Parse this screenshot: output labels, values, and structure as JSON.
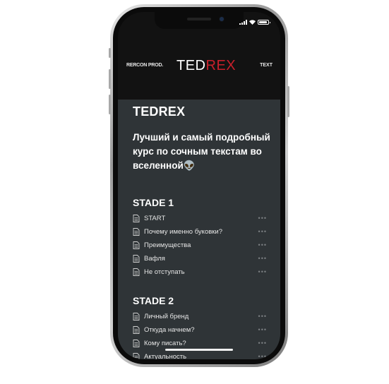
{
  "header": {
    "left_text": "RERCON PROD.",
    "logo_part1": "TED",
    "logo_part2": "REX",
    "right_text": "TEXT"
  },
  "page": {
    "title": "TEDREX",
    "subtitle": "Лучший и самый подробный курс по сочным текстам во вселенной👽"
  },
  "sections": [
    {
      "title": "STADE 1",
      "items": [
        "START",
        "Почему именно буковки?",
        "Преимущества",
        "Вафля",
        "Не отступать"
      ]
    },
    {
      "title": "STADE 2",
      "items": [
        "Личный бренд",
        "Откуда начнем?",
        "Кому писать?",
        "Актуальность"
      ]
    }
  ],
  "icons": {
    "page": "document-icon",
    "more": "more-dots-icon"
  },
  "colors": {
    "accent": "#c8202b",
    "content_bg": "#2f3437",
    "header_bg": "#121212"
  }
}
